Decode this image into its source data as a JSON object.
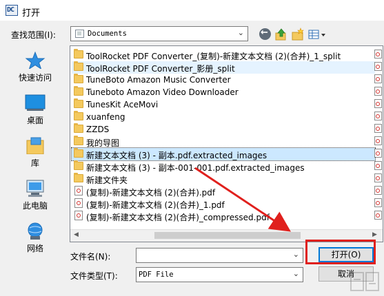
{
  "window": {
    "title": "打开"
  },
  "toolbar": {
    "look_in_label": "查找范围(I):",
    "look_in_value": "Documents"
  },
  "places": [
    {
      "label": "快速访问",
      "icon": "star-icon"
    },
    {
      "label": "桌面",
      "icon": "desktop-icon"
    },
    {
      "label": "库",
      "icon": "library-icon"
    },
    {
      "label": "此电脑",
      "icon": "computer-icon"
    },
    {
      "label": "网络",
      "icon": "network-icon"
    }
  ],
  "files": [
    {
      "name": "ToolRocket PDF Converter_(复制)-新建文本文档 (2)(合并)_1_split",
      "type": "folder",
      "state": "normal"
    },
    {
      "name": "ToolRocket PDF Converter_影册_split",
      "type": "folder",
      "state": "hover"
    },
    {
      "name": "TuneBoto Amazon Music Converter",
      "type": "folder",
      "state": "normal"
    },
    {
      "name": "Tuneboto Amazon Video Downloader",
      "type": "folder",
      "state": "normal"
    },
    {
      "name": "TunesKit AceMovi",
      "type": "folder",
      "state": "normal"
    },
    {
      "name": "xuanfeng",
      "type": "folder",
      "state": "normal"
    },
    {
      "name": "ZZDS",
      "type": "folder",
      "state": "normal"
    },
    {
      "name": "我的导图",
      "type": "folder",
      "state": "normal"
    },
    {
      "name": "新建文本文档 (3) - 副本.pdf.extracted_images",
      "type": "folder",
      "state": "focused"
    },
    {
      "name": "新建文本文档 (3) - 副本-001-001.pdf.extracted_images",
      "type": "folder",
      "state": "normal"
    },
    {
      "name": "新建文件夹",
      "type": "folder",
      "state": "normal"
    },
    {
      "name": "(复制)-新建文本文档 (2)(合并).pdf",
      "type": "pdf",
      "state": "normal"
    },
    {
      "name": "(复制)-新建文本文档 (2)(合并)_1.pdf",
      "type": "pdf",
      "state": "normal"
    },
    {
      "name": "(复制)-新建文本文档 (2)(合并)_compressed.pdf",
      "type": "pdf",
      "state": "normal"
    }
  ],
  "form": {
    "filename_label": "文件名(N):",
    "filename_value": "",
    "filetype_label": "文件类型(T):",
    "filetype_value": "PDF File"
  },
  "buttons": {
    "open": "打开(O)",
    "cancel": "取消"
  },
  "colors": {
    "selection": "#cce8ff",
    "annotation": "#e0201d",
    "accent": "#0078d7"
  }
}
